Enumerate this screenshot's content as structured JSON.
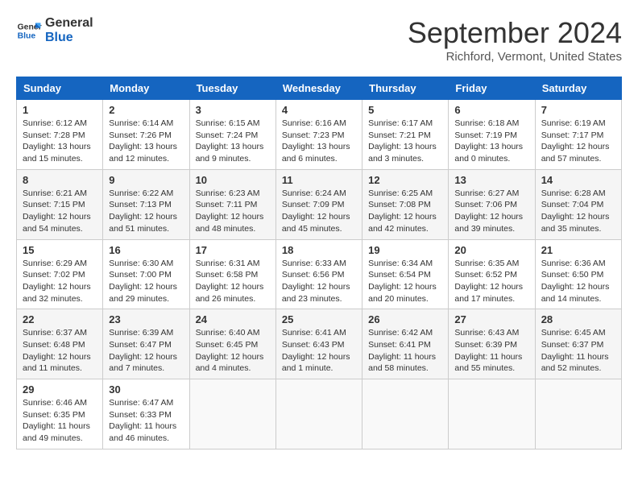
{
  "header": {
    "logo_line1": "General",
    "logo_line2": "Blue",
    "month_title": "September 2024",
    "subtitle": "Richford, Vermont, United States"
  },
  "weekdays": [
    "Sunday",
    "Monday",
    "Tuesday",
    "Wednesday",
    "Thursday",
    "Friday",
    "Saturday"
  ],
  "weeks": [
    [
      {
        "day": "1",
        "info": "Sunrise: 6:12 AM\nSunset: 7:28 PM\nDaylight: 13 hours\nand 15 minutes."
      },
      {
        "day": "2",
        "info": "Sunrise: 6:14 AM\nSunset: 7:26 PM\nDaylight: 13 hours\nand 12 minutes."
      },
      {
        "day": "3",
        "info": "Sunrise: 6:15 AM\nSunset: 7:24 PM\nDaylight: 13 hours\nand 9 minutes."
      },
      {
        "day": "4",
        "info": "Sunrise: 6:16 AM\nSunset: 7:23 PM\nDaylight: 13 hours\nand 6 minutes."
      },
      {
        "day": "5",
        "info": "Sunrise: 6:17 AM\nSunset: 7:21 PM\nDaylight: 13 hours\nand 3 minutes."
      },
      {
        "day": "6",
        "info": "Sunrise: 6:18 AM\nSunset: 7:19 PM\nDaylight: 13 hours\nand 0 minutes."
      },
      {
        "day": "7",
        "info": "Sunrise: 6:19 AM\nSunset: 7:17 PM\nDaylight: 12 hours\nand 57 minutes."
      }
    ],
    [
      {
        "day": "8",
        "info": "Sunrise: 6:21 AM\nSunset: 7:15 PM\nDaylight: 12 hours\nand 54 minutes."
      },
      {
        "day": "9",
        "info": "Sunrise: 6:22 AM\nSunset: 7:13 PM\nDaylight: 12 hours\nand 51 minutes."
      },
      {
        "day": "10",
        "info": "Sunrise: 6:23 AM\nSunset: 7:11 PM\nDaylight: 12 hours\nand 48 minutes."
      },
      {
        "day": "11",
        "info": "Sunrise: 6:24 AM\nSunset: 7:09 PM\nDaylight: 12 hours\nand 45 minutes."
      },
      {
        "day": "12",
        "info": "Sunrise: 6:25 AM\nSunset: 7:08 PM\nDaylight: 12 hours\nand 42 minutes."
      },
      {
        "day": "13",
        "info": "Sunrise: 6:27 AM\nSunset: 7:06 PM\nDaylight: 12 hours\nand 39 minutes."
      },
      {
        "day": "14",
        "info": "Sunrise: 6:28 AM\nSunset: 7:04 PM\nDaylight: 12 hours\nand 35 minutes."
      }
    ],
    [
      {
        "day": "15",
        "info": "Sunrise: 6:29 AM\nSunset: 7:02 PM\nDaylight: 12 hours\nand 32 minutes."
      },
      {
        "day": "16",
        "info": "Sunrise: 6:30 AM\nSunset: 7:00 PM\nDaylight: 12 hours\nand 29 minutes."
      },
      {
        "day": "17",
        "info": "Sunrise: 6:31 AM\nSunset: 6:58 PM\nDaylight: 12 hours\nand 26 minutes."
      },
      {
        "day": "18",
        "info": "Sunrise: 6:33 AM\nSunset: 6:56 PM\nDaylight: 12 hours\nand 23 minutes."
      },
      {
        "day": "19",
        "info": "Sunrise: 6:34 AM\nSunset: 6:54 PM\nDaylight: 12 hours\nand 20 minutes."
      },
      {
        "day": "20",
        "info": "Sunrise: 6:35 AM\nSunset: 6:52 PM\nDaylight: 12 hours\nand 17 minutes."
      },
      {
        "day": "21",
        "info": "Sunrise: 6:36 AM\nSunset: 6:50 PM\nDaylight: 12 hours\nand 14 minutes."
      }
    ],
    [
      {
        "day": "22",
        "info": "Sunrise: 6:37 AM\nSunset: 6:48 PM\nDaylight: 12 hours\nand 11 minutes."
      },
      {
        "day": "23",
        "info": "Sunrise: 6:39 AM\nSunset: 6:47 PM\nDaylight: 12 hours\nand 7 minutes."
      },
      {
        "day": "24",
        "info": "Sunrise: 6:40 AM\nSunset: 6:45 PM\nDaylight: 12 hours\nand 4 minutes."
      },
      {
        "day": "25",
        "info": "Sunrise: 6:41 AM\nSunset: 6:43 PM\nDaylight: 12 hours\nand 1 minute."
      },
      {
        "day": "26",
        "info": "Sunrise: 6:42 AM\nSunset: 6:41 PM\nDaylight: 11 hours\nand 58 minutes."
      },
      {
        "day": "27",
        "info": "Sunrise: 6:43 AM\nSunset: 6:39 PM\nDaylight: 11 hours\nand 55 minutes."
      },
      {
        "day": "28",
        "info": "Sunrise: 6:45 AM\nSunset: 6:37 PM\nDaylight: 11 hours\nand 52 minutes."
      }
    ],
    [
      {
        "day": "29",
        "info": "Sunrise: 6:46 AM\nSunset: 6:35 PM\nDaylight: 11 hours\nand 49 minutes."
      },
      {
        "day": "30",
        "info": "Sunrise: 6:47 AM\nSunset: 6:33 PM\nDaylight: 11 hours\nand 46 minutes."
      },
      {
        "day": "",
        "info": ""
      },
      {
        "day": "",
        "info": ""
      },
      {
        "day": "",
        "info": ""
      },
      {
        "day": "",
        "info": ""
      },
      {
        "day": "",
        "info": ""
      }
    ]
  ]
}
